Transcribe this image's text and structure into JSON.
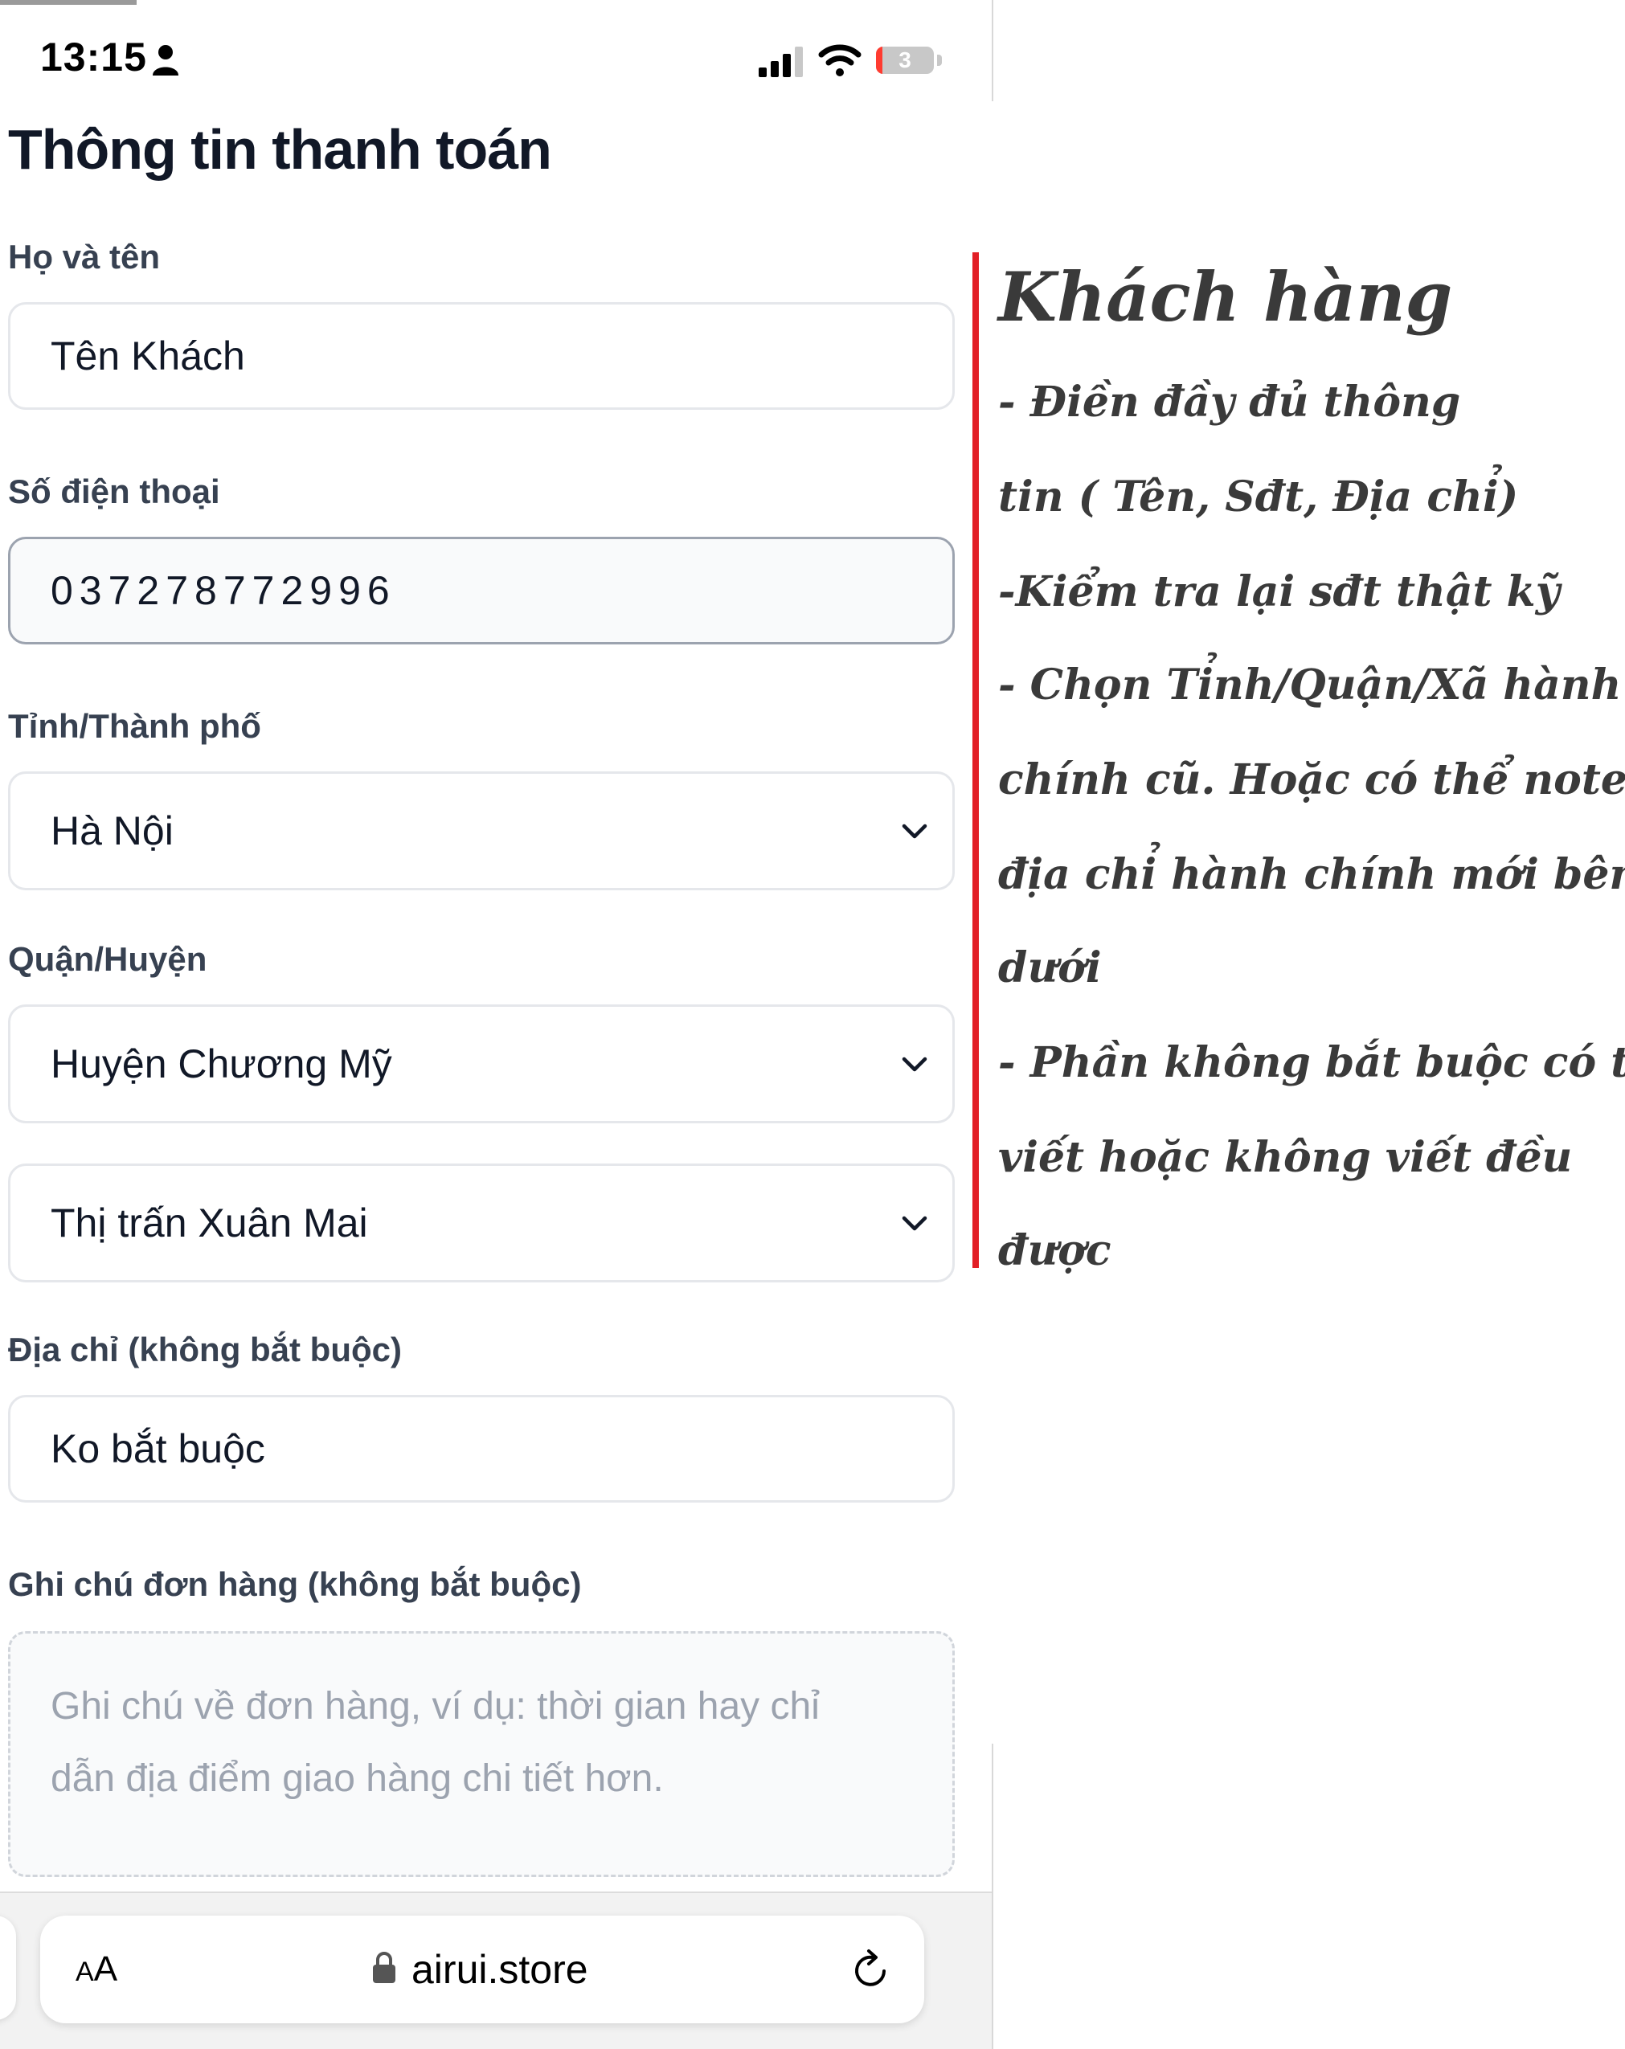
{
  "status_bar": {
    "time": "13:15",
    "battery_level": "3",
    "battery_color": "#ff3b30",
    "icons": [
      "person-icon",
      "signal-icon",
      "wifi-icon",
      "battery-icon"
    ]
  },
  "page": {
    "title": "Thông tin thanh toán"
  },
  "form": {
    "name": {
      "label": "Họ và tên",
      "value": "Tên Khách"
    },
    "phone": {
      "label": "Số điện thoại",
      "value": "037278772996"
    },
    "province": {
      "label": "Tỉnh/Thành phố",
      "value": "Hà Nội"
    },
    "district": {
      "label": "Quận/Huyện",
      "value": "Huyện Chương Mỹ"
    },
    "ward": {
      "value": "Thị trấn Xuân Mai"
    },
    "address": {
      "label": "Địa chỉ (không bắt buộc)",
      "value": "Ko bắt buộc"
    },
    "note": {
      "label": "Ghi chú đơn hàng (không bắt buộc)",
      "placeholder": "Ghi chú về đơn hàng, ví dụ: thời gian hay chỉ dẫn địa điểm giao hàng chi tiết hơn."
    }
  },
  "browser": {
    "aa_small": "A",
    "aa_large": "A",
    "url": "airui.store",
    "icons": [
      "lock-icon",
      "reload-icon"
    ]
  },
  "annotation": {
    "heading": "Khách hàng",
    "accent_color": "#e21f26",
    "lines": [
      "- Điền đầy đủ thông",
      "tin ( Tên, Sđt, Địa chỉ)",
      "-Kiểm tra lại sđt thật kỹ",
      "- Chọn Tỉnh/Quận/Xã hành",
      "chính cũ. Hoặc có thể note",
      "địa chỉ hành chính mới bên",
      " dưới",
      "- Phần không bắt buộc có thể",
      "viết hoặc không viết đều",
      "được"
    ]
  }
}
